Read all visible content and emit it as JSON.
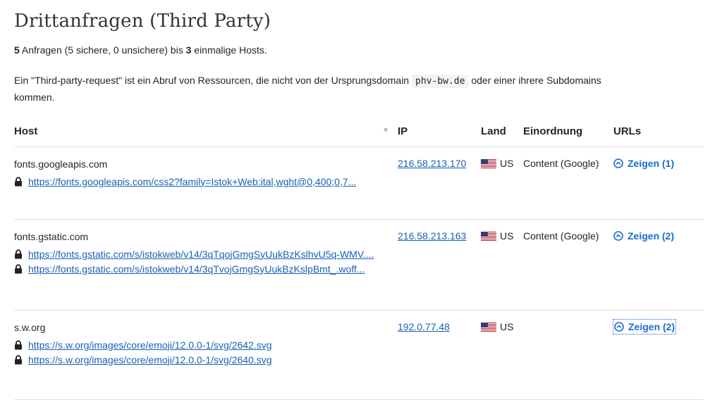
{
  "title": "Drittanfragen (Third Party)",
  "summary": {
    "requests": "5",
    "text_a": " Anfragen (5 sichere, 0 unsichere) bis ",
    "hosts": "3",
    "text_b": " einmalige Hosts."
  },
  "description": {
    "before": "Ein \"Third-party-request\" ist ein Abruf von Ressourcen, die nicht von der Ursprungsdomain ",
    "domain": "phv-bw.de",
    "after": " oder einer ihrere Subdomains kommen."
  },
  "table": {
    "headers": {
      "host": "Host",
      "ip": "IP",
      "land": "Land",
      "category": "Einordnung",
      "urls": "URLs"
    },
    "sort_icon": "sort-caret-icon",
    "rows": [
      {
        "host": "fonts.googleapis.com",
        "urls": [
          "https://fonts.googleapis.com/css2?family=Istok+Web:ital,wght@0,400;0,7..."
        ],
        "ip": "216.58.213.170",
        "country": "US",
        "category": "Content (Google)",
        "show": "Zeigen (1)"
      },
      {
        "host": "fonts.gstatic.com",
        "urls": [
          "https://fonts.gstatic.com/s/istokweb/v14/3qTqojGmgSyUukBzKslhvU5q-WMV....",
          "https://fonts.gstatic.com/s/istokweb/v14/3qTvojGmgSyUukBzKslpBmt_.woff..."
        ],
        "ip": "216.58.213.163",
        "country": "US",
        "category": "Content (Google)",
        "show": "Zeigen (2)"
      },
      {
        "host": "s.w.org",
        "urls": [
          "https://s.w.org/images/core/emoji/12.0.0-1/svg/2642.svg",
          "https://s.w.org/images/core/emoji/12.0.0-1/svg/2640.svg"
        ],
        "ip": "192.0.77.48",
        "country": "US",
        "category": "",
        "show": "Zeigen (2)"
      }
    ]
  },
  "colors": {
    "link": "#1a5fb4",
    "accent": "#1a6bd0",
    "border": "#dee2e6",
    "text": "#212529"
  },
  "icons": {
    "lock": "lock-icon",
    "flag": "us-flag-icon",
    "chevron": "chevron-up-circle-icon"
  }
}
